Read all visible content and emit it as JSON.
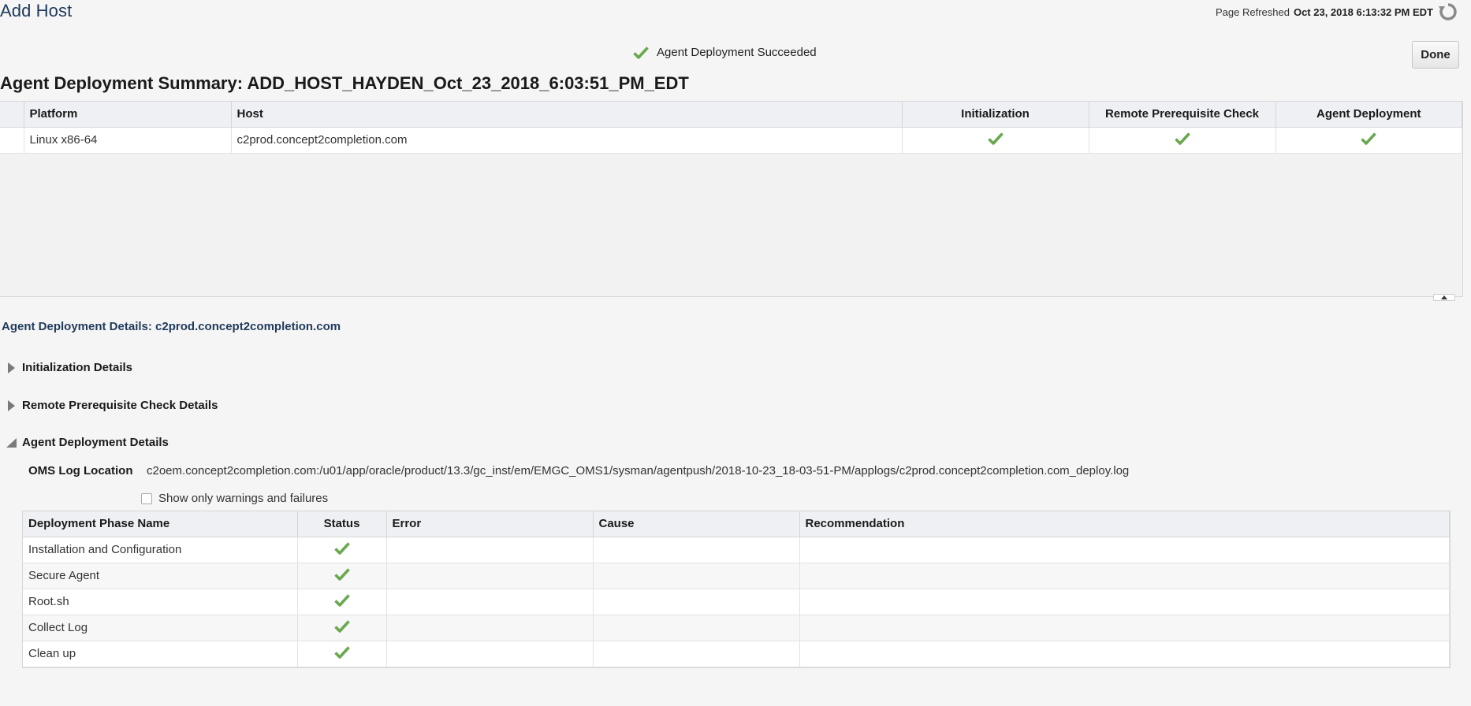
{
  "header": {
    "title": "Add Host",
    "refreshed_label": "Page Refreshed",
    "refreshed_value": "Oct 23, 2018 6:13:32 PM EDT"
  },
  "status": {
    "message": "Agent Deployment Succeeded"
  },
  "actions": {
    "done_label": "Done"
  },
  "summary": {
    "title": "Agent Deployment Summary: ADD_HOST_HAYDEN_Oct_23_2018_6:03:51_PM_EDT",
    "columns": [
      "Platform",
      "Host",
      "Initialization",
      "Remote Prerequisite Check",
      "Agent Deployment"
    ],
    "rows": [
      {
        "platform": "Linux x86-64",
        "host": "c2prod.concept2completion.com",
        "initialization": "success",
        "prereq": "success",
        "deployment": "success"
      }
    ]
  },
  "details": {
    "title": "Agent Deployment Details: c2prod.concept2completion.com",
    "sections": [
      {
        "label": "Initialization Details",
        "expanded": false
      },
      {
        "label": "Remote Prerequisite Check Details",
        "expanded": false
      },
      {
        "label": "Agent Deployment Details",
        "expanded": true
      }
    ],
    "oms_log_label": "OMS Log Location",
    "oms_log_value": "c2oem.concept2completion.com:/u01/app/oracle/product/13.3/gc_inst/em/EMGC_OMS1/sysman/agentpush/2018-10-23_18-03-51-PM/applogs/c2prod.concept2completion.com_deploy.log",
    "warnings_checkbox_label": "Show only warnings and failures",
    "warnings_checked": false,
    "phase_columns": [
      "Deployment Phase Name",
      "Status",
      "Error",
      "Cause",
      "Recommendation"
    ],
    "phases": [
      {
        "name": "Installation and Configuration",
        "status": "success",
        "error": "",
        "cause": "",
        "recommendation": ""
      },
      {
        "name": "Secure Agent",
        "status": "success",
        "error": "",
        "cause": "",
        "recommendation": ""
      },
      {
        "name": "Root.sh",
        "status": "success",
        "error": "",
        "cause": "",
        "recommendation": ""
      },
      {
        "name": "Collect Log",
        "status": "success",
        "error": "",
        "cause": "",
        "recommendation": ""
      },
      {
        "name": "Clean up",
        "status": "success",
        "error": "",
        "cause": "",
        "recommendation": ""
      }
    ]
  },
  "colors": {
    "success_check": "#6aa84f",
    "title_blue": "#1f3a5c"
  },
  "icons": [
    "refresh-icon",
    "checkmark-icon",
    "expand-triangle-icon",
    "collapse-triangle-icon"
  ]
}
